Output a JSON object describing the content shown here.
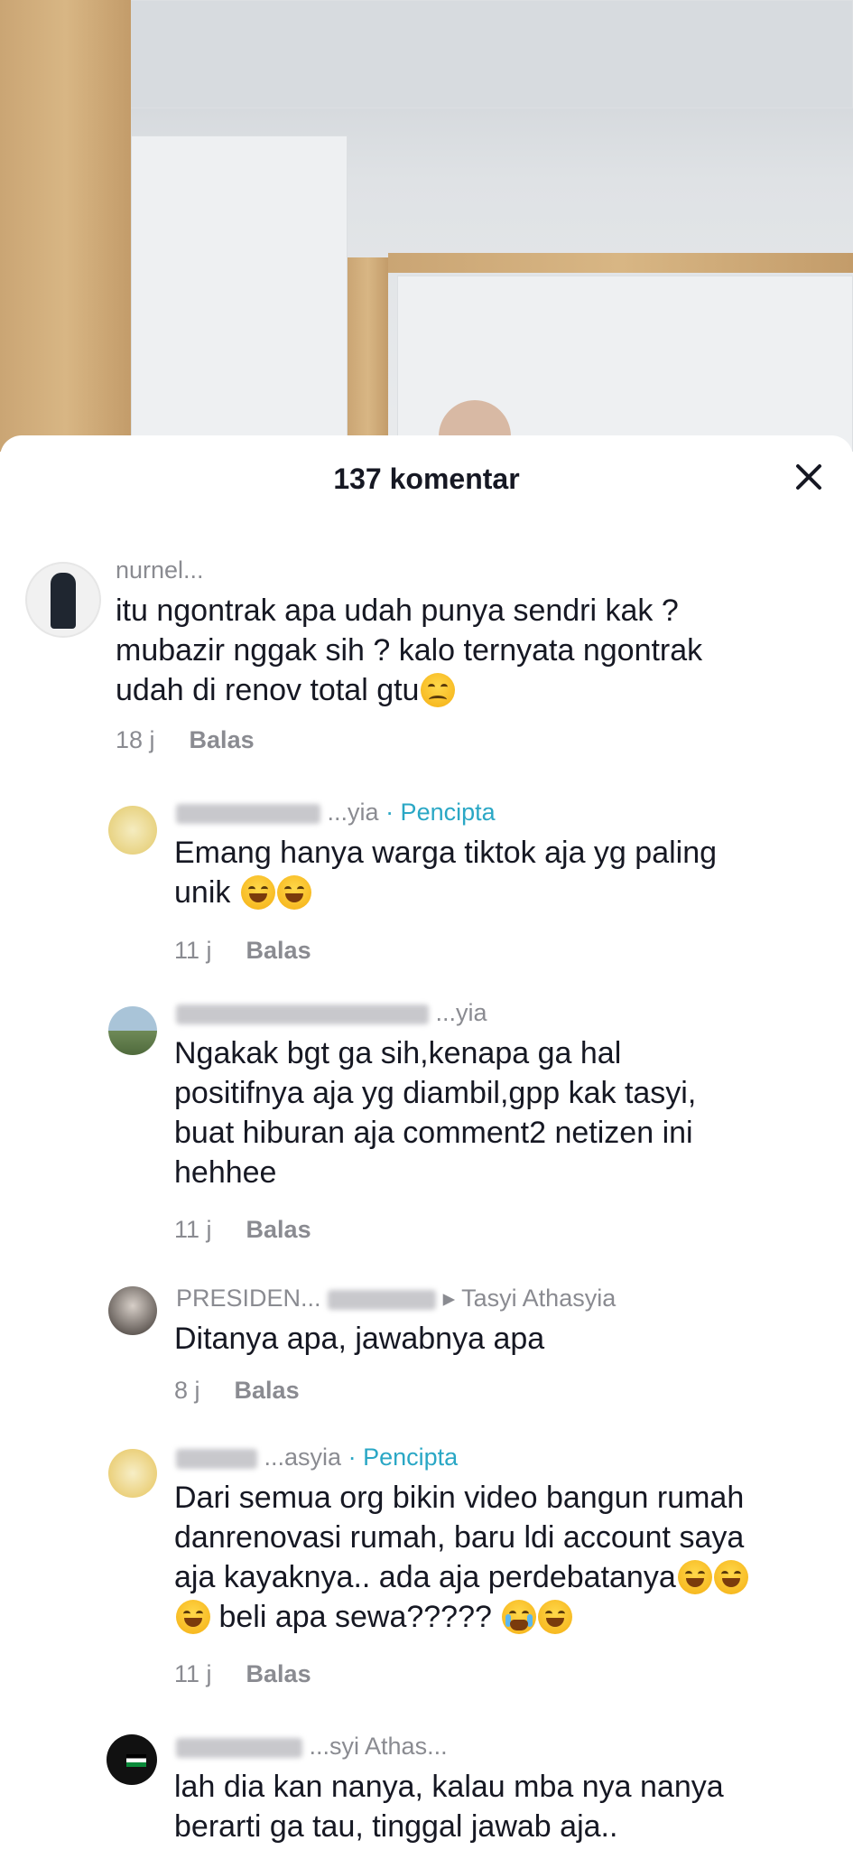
{
  "sheet": {
    "title": "137 komentar"
  },
  "comments": [
    {
      "username": "nurnel...",
      "lines": [
        "itu ngontrak apa udah punya sendri kak ?",
        "mubazir nggak sih ? kalo ternyata ngontrak",
        "udah di renov total gtu"
      ],
      "time": "18 j",
      "reply": "Balas"
    },
    {
      "username": "...yia",
      "creator": "· Pencipta",
      "lines": [
        "Emang hanya warga tiktok aja yg paling",
        "unik "
      ],
      "time": "11 j",
      "reply": "Balas"
    },
    {
      "username": "...yia",
      "lines": [
        "Ngakak bgt ga sih,kenapa ga hal",
        "positifnya aja yg diambil,gpp kak tasyi,",
        "buat hiburan aja comment2 netizen ini",
        "hehhee"
      ],
      "time": "11 j",
      "reply": "Balas"
    },
    {
      "username": "PRESIDEN...",
      "target": "▸ Tasyi Athasyia",
      "lines": [
        "Ditanya apa, jawabnya apa"
      ],
      "time": "8 j",
      "reply": "Balas"
    },
    {
      "username": "...asyia",
      "creator": "· Pencipta",
      "lines": [
        "Dari semua org bikin video bangun rumah",
        "danrenovasi rumah, baru ldi account saya",
        "aja kayaknya.. ada aja perdebatanya",
        " beli apa sewa????? "
      ],
      "time": "11 j",
      "reply": "Balas"
    },
    {
      "username": "...syi Athas...",
      "lines": [
        "lah dia kan nanya, kalau mba nya nanya",
        "berarti ga tau, tinggal jawab aja.."
      ]
    }
  ],
  "colors": {
    "accent": "#2aa7c5",
    "secondary_text": "#8a8b91",
    "primary_text": "#161823"
  }
}
